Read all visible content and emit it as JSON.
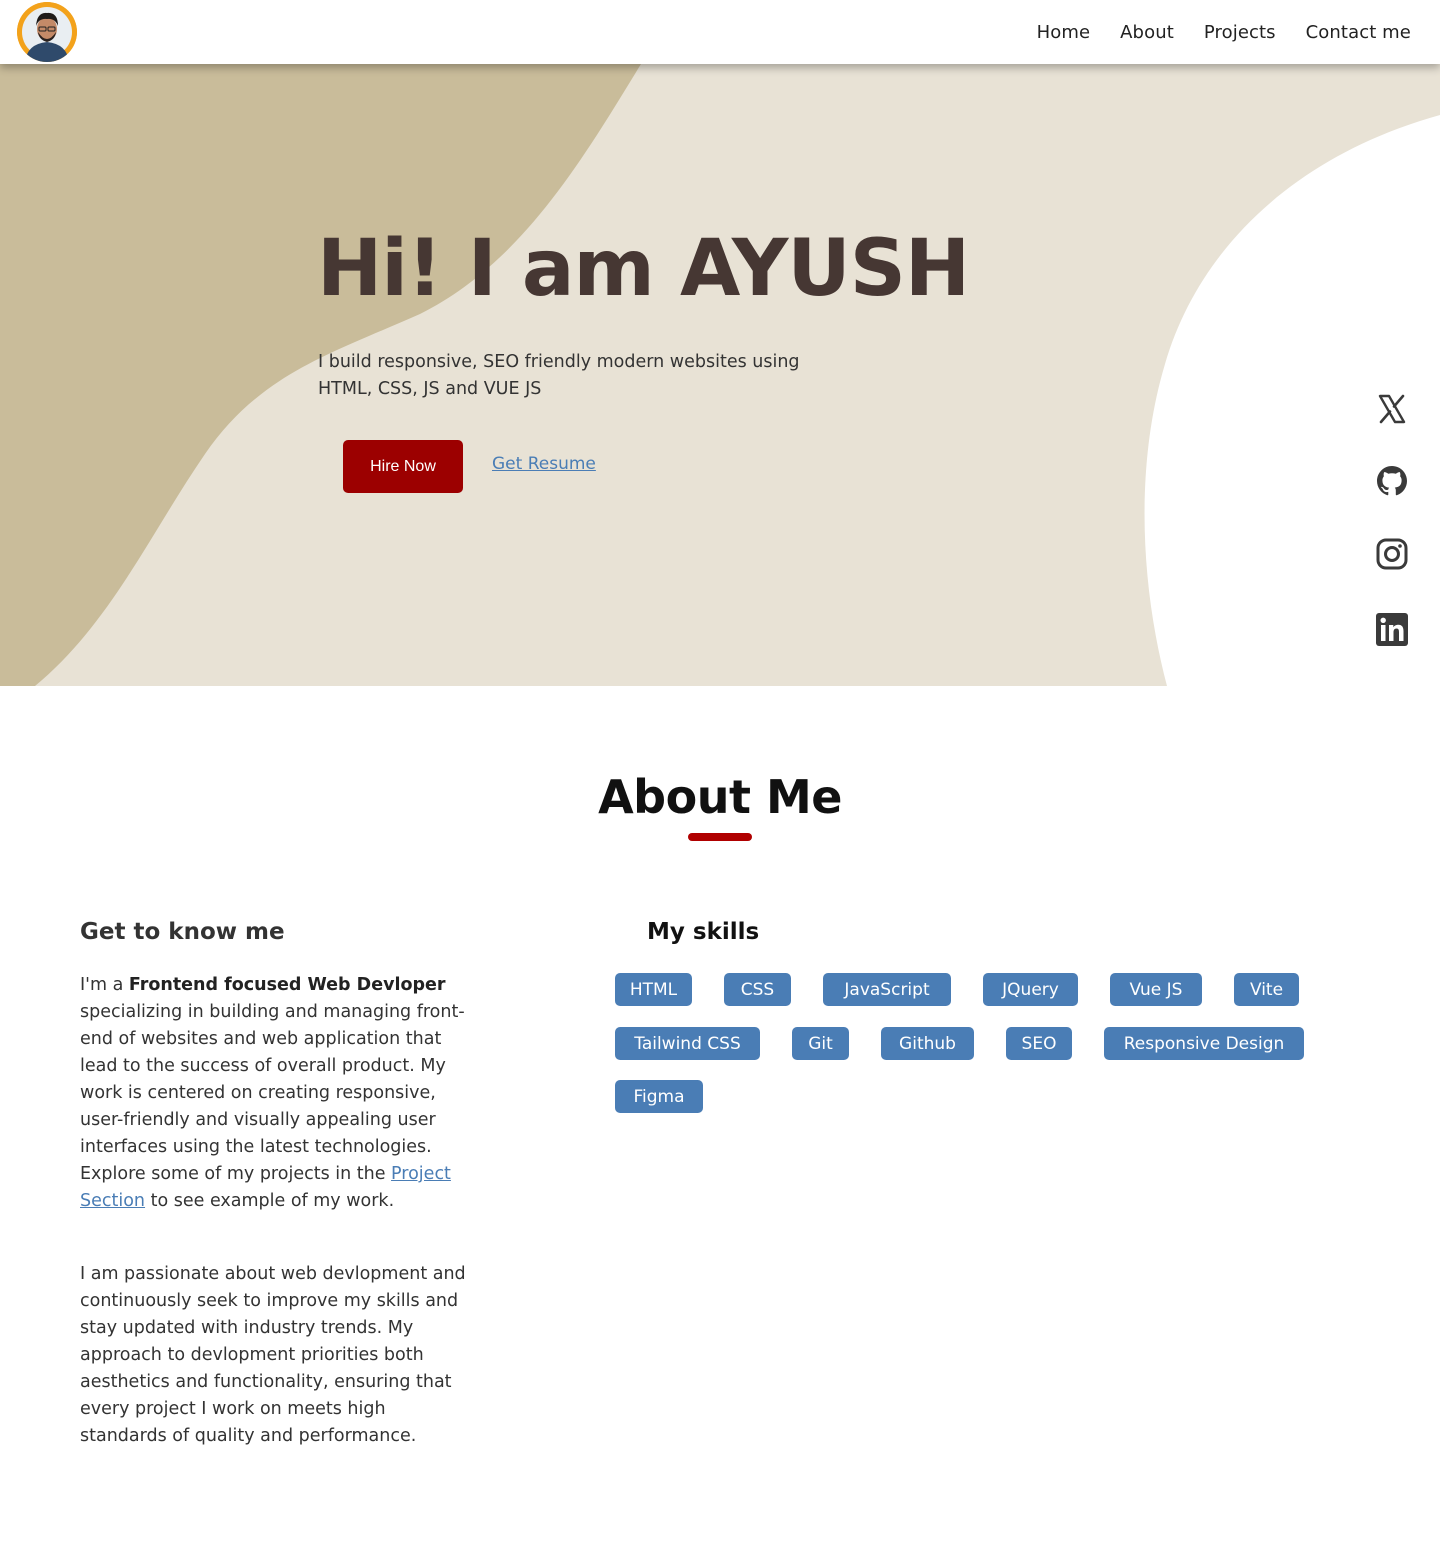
{
  "nav": {
    "links": [
      "Home",
      "About",
      "Projects",
      "Contact me"
    ]
  },
  "hero": {
    "title": "Hi! I am AYUSH",
    "subtitle": "I build responsive, SEO friendly modern websites using HTML, CSS, JS and VUE JS",
    "hire_label": "Hire Now",
    "resume_label": "Get Resume"
  },
  "social": [
    "x-icon",
    "github-icon",
    "instagram-icon",
    "linkedin-icon"
  ],
  "about": {
    "title": "About Me",
    "know_title": "Get to know me",
    "p1_prefix": "I'm a ",
    "p1_bold": "Frontend focused Web Devloper",
    "p1_middle": " specializing in building and managing front-end of websites and web application that lead to the success of overall product. My work is centered on creating responsive, user-friendly and visually appealing user interfaces using the latest technologies. Explore some of my projects in the ",
    "p1_link": "Project Section",
    "p1_suffix": " to see example of my work.",
    "p2": "I am passionate about web devlopment and continuously seek to improve my skills and stay updated with industry trends. My approach to devlopment priorities both aesthetics and functionality, ensuring that every project I work on meets high standards of quality and performance.",
    "skills_title": "My skills",
    "skills": [
      "HTML",
      "CSS",
      "JavaScript",
      "JQuery",
      "Vue JS",
      "Vite",
      "Tailwind CSS",
      "Git",
      "Github",
      "SEO",
      "Responsive Design",
      "Figma"
    ]
  },
  "colors": {
    "hero_light": "#e8e2d5",
    "hero_dark": "#c9bc9a",
    "accent_red": "#9c0000",
    "skill_blue": "#4a7db5",
    "title_brown": "#463733"
  }
}
